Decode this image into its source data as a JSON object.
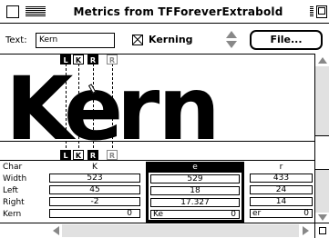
{
  "window": {
    "title": "Metrics from TFForeverExtrabold"
  },
  "toolbar": {
    "text_label": "Text:",
    "text_value": "Kern",
    "kerning_label": "Kerning",
    "kerning_checked": true,
    "file_button": "File..."
  },
  "preview": {
    "glyphs": [
      "K",
      "e",
      "rn"
    ],
    "markers_top": [
      "L",
      "K",
      "R",
      "R"
    ],
    "markers_bottom": [
      "L",
      "K",
      "R",
      "R"
    ]
  },
  "metrics": {
    "row_labels": [
      "Char",
      "Width",
      "Left",
      "Right",
      "Kern"
    ],
    "columns": [
      {
        "char": "K",
        "width": "523",
        "left": "45",
        "right": "-2",
        "kern": "0",
        "kern_pair": "",
        "selected": false
      },
      {
        "char": "e",
        "width": "529",
        "left": "18",
        "right": "17.327",
        "kern": "0",
        "kern_pair": "Ke",
        "selected": true
      },
      {
        "char": "r",
        "width": "433",
        "left": "24",
        "right": "14",
        "kern": "0",
        "kern_pair": "er",
        "selected": false
      }
    ]
  },
  "icons": {
    "close": "close-box-icon",
    "zoom": "zoom-box-icon",
    "stepper": "stepper-arrows-icon",
    "cursor": "arrow-cursor-icon",
    "grow": "grow-box-icon"
  }
}
